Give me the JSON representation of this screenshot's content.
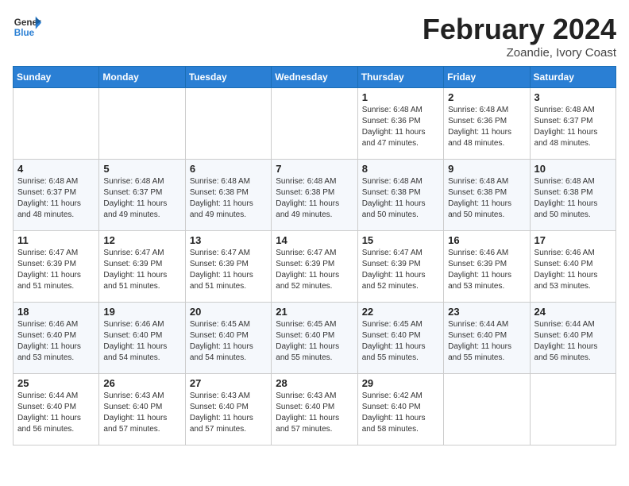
{
  "header": {
    "logo_line1": "General",
    "logo_line2": "Blue",
    "month_title": "February 2024",
    "location": "Zoandie, Ivory Coast"
  },
  "weekdays": [
    "Sunday",
    "Monday",
    "Tuesday",
    "Wednesday",
    "Thursday",
    "Friday",
    "Saturday"
  ],
  "weeks": [
    [
      {
        "day": "",
        "info": ""
      },
      {
        "day": "",
        "info": ""
      },
      {
        "day": "",
        "info": ""
      },
      {
        "day": "",
        "info": ""
      },
      {
        "day": "1",
        "info": "Sunrise: 6:48 AM\nSunset: 6:36 PM\nDaylight: 11 hours\nand 47 minutes."
      },
      {
        "day": "2",
        "info": "Sunrise: 6:48 AM\nSunset: 6:36 PM\nDaylight: 11 hours\nand 48 minutes."
      },
      {
        "day": "3",
        "info": "Sunrise: 6:48 AM\nSunset: 6:37 PM\nDaylight: 11 hours\nand 48 minutes."
      }
    ],
    [
      {
        "day": "4",
        "info": "Sunrise: 6:48 AM\nSunset: 6:37 PM\nDaylight: 11 hours\nand 48 minutes."
      },
      {
        "day": "5",
        "info": "Sunrise: 6:48 AM\nSunset: 6:37 PM\nDaylight: 11 hours\nand 49 minutes."
      },
      {
        "day": "6",
        "info": "Sunrise: 6:48 AM\nSunset: 6:38 PM\nDaylight: 11 hours\nand 49 minutes."
      },
      {
        "day": "7",
        "info": "Sunrise: 6:48 AM\nSunset: 6:38 PM\nDaylight: 11 hours\nand 49 minutes."
      },
      {
        "day": "8",
        "info": "Sunrise: 6:48 AM\nSunset: 6:38 PM\nDaylight: 11 hours\nand 50 minutes."
      },
      {
        "day": "9",
        "info": "Sunrise: 6:48 AM\nSunset: 6:38 PM\nDaylight: 11 hours\nand 50 minutes."
      },
      {
        "day": "10",
        "info": "Sunrise: 6:48 AM\nSunset: 6:38 PM\nDaylight: 11 hours\nand 50 minutes."
      }
    ],
    [
      {
        "day": "11",
        "info": "Sunrise: 6:47 AM\nSunset: 6:39 PM\nDaylight: 11 hours\nand 51 minutes."
      },
      {
        "day": "12",
        "info": "Sunrise: 6:47 AM\nSunset: 6:39 PM\nDaylight: 11 hours\nand 51 minutes."
      },
      {
        "day": "13",
        "info": "Sunrise: 6:47 AM\nSunset: 6:39 PM\nDaylight: 11 hours\nand 51 minutes."
      },
      {
        "day": "14",
        "info": "Sunrise: 6:47 AM\nSunset: 6:39 PM\nDaylight: 11 hours\nand 52 minutes."
      },
      {
        "day": "15",
        "info": "Sunrise: 6:47 AM\nSunset: 6:39 PM\nDaylight: 11 hours\nand 52 minutes."
      },
      {
        "day": "16",
        "info": "Sunrise: 6:46 AM\nSunset: 6:39 PM\nDaylight: 11 hours\nand 53 minutes."
      },
      {
        "day": "17",
        "info": "Sunrise: 6:46 AM\nSunset: 6:40 PM\nDaylight: 11 hours\nand 53 minutes."
      }
    ],
    [
      {
        "day": "18",
        "info": "Sunrise: 6:46 AM\nSunset: 6:40 PM\nDaylight: 11 hours\nand 53 minutes."
      },
      {
        "day": "19",
        "info": "Sunrise: 6:46 AM\nSunset: 6:40 PM\nDaylight: 11 hours\nand 54 minutes."
      },
      {
        "day": "20",
        "info": "Sunrise: 6:45 AM\nSunset: 6:40 PM\nDaylight: 11 hours\nand 54 minutes."
      },
      {
        "day": "21",
        "info": "Sunrise: 6:45 AM\nSunset: 6:40 PM\nDaylight: 11 hours\nand 55 minutes."
      },
      {
        "day": "22",
        "info": "Sunrise: 6:45 AM\nSunset: 6:40 PM\nDaylight: 11 hours\nand 55 minutes."
      },
      {
        "day": "23",
        "info": "Sunrise: 6:44 AM\nSunset: 6:40 PM\nDaylight: 11 hours\nand 55 minutes."
      },
      {
        "day": "24",
        "info": "Sunrise: 6:44 AM\nSunset: 6:40 PM\nDaylight: 11 hours\nand 56 minutes."
      }
    ],
    [
      {
        "day": "25",
        "info": "Sunrise: 6:44 AM\nSunset: 6:40 PM\nDaylight: 11 hours\nand 56 minutes."
      },
      {
        "day": "26",
        "info": "Sunrise: 6:43 AM\nSunset: 6:40 PM\nDaylight: 11 hours\nand 57 minutes."
      },
      {
        "day": "27",
        "info": "Sunrise: 6:43 AM\nSunset: 6:40 PM\nDaylight: 11 hours\nand 57 minutes."
      },
      {
        "day": "28",
        "info": "Sunrise: 6:43 AM\nSunset: 6:40 PM\nDaylight: 11 hours\nand 57 minutes."
      },
      {
        "day": "29",
        "info": "Sunrise: 6:42 AM\nSunset: 6:40 PM\nDaylight: 11 hours\nand 58 minutes."
      },
      {
        "day": "",
        "info": ""
      },
      {
        "day": "",
        "info": ""
      }
    ]
  ]
}
